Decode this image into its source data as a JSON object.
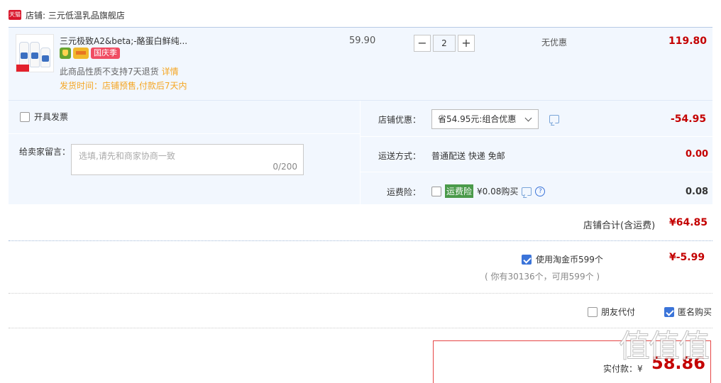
{
  "shop": {
    "badge": "天猫",
    "name": "店铺: 三元低温乳品旗舰店"
  },
  "item": {
    "title": "三元极致A2&beta;-酪蛋白鲜纯...",
    "badge_label": "国庆季",
    "price": "59.90",
    "quantity": "2",
    "minus": "−",
    "plus": "+",
    "discount": "无优惠",
    "total": "119.80",
    "no_return": "此商品性质不支持7天退货",
    "detail_link": "详情",
    "ship_time": "发货时间：店铺预售,付款后7天内"
  },
  "options": {
    "invoice_label": "开具发票",
    "message_label": "给卖家留言：",
    "message_placeholder": "选填,请先和商家协商一致",
    "message_count": "0/200",
    "shop_discount_label": "店铺优惠：",
    "shop_discount_value": "省54.95元:组合优惠",
    "shop_discount_amount": "-54.95",
    "shipping_label": "运送方式：",
    "shipping_value": "普通配送 快递 免邮",
    "shipping_amount": "0.00",
    "insurance_label": "运费险：",
    "insurance_tag": "运费险",
    "insurance_value": "¥0.08购买",
    "insurance_amount": "0.08",
    "help": "?"
  },
  "summary": {
    "subtotal_label": "店铺合计(含运费)",
    "subtotal_amount": "¥64.85",
    "coin_label": "使用淘金币599个",
    "coin_amount": "¥-5.99",
    "coin_note": "( 你有30136个，可用599个 )",
    "friend_pay": "朋友代付",
    "anonymous": "匿名购买",
    "pay_label": "实付款：¥",
    "pay_amount": "58.86"
  },
  "watermark": "值值值"
}
